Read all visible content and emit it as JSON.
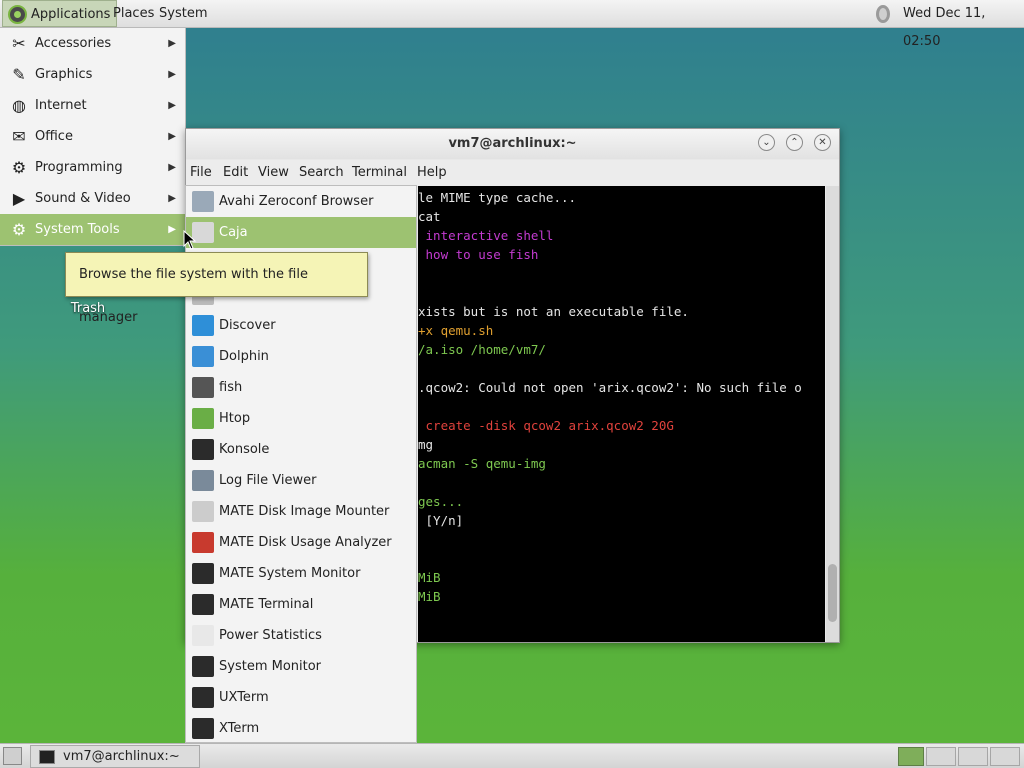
{
  "top_panel": {
    "applications": "Applications",
    "places": "Places",
    "system": "System",
    "clock": "Wed Dec 11, 02:50"
  },
  "desktop": {
    "trash": "Trash"
  },
  "main_menu": {
    "items": [
      {
        "label": "Accessories",
        "icon": "accessories-icon"
      },
      {
        "label": "Graphics",
        "icon": "graphics-icon"
      },
      {
        "label": "Internet",
        "icon": "internet-icon"
      },
      {
        "label": "Office",
        "icon": "office-icon"
      },
      {
        "label": "Programming",
        "icon": "programming-icon"
      },
      {
        "label": "Sound & Video",
        "icon": "sound-video-icon"
      },
      {
        "label": "System Tools",
        "icon": "system-tools-icon",
        "active": true
      }
    ]
  },
  "tooltip": "Browse the file system with the file manager",
  "terminal": {
    "title": "vm7@archlinux:~",
    "menu": [
      "File",
      "Edit",
      "View",
      "Search",
      "Terminal",
      "Help"
    ],
    "lines": [
      {
        "text": "le MIME type cache...",
        "color": "#e6e6e6"
      },
      {
        "text": "cat",
        "color": "#e6e6e6"
      },
      {
        "text": " interactive shell",
        "color": "#c43bd1"
      },
      {
        "text": " how to use fish",
        "color": "#c43bd1"
      },
      {
        "text": "",
        "color": "#e6e6e6"
      },
      {
        "text": "",
        "color": "#e6e6e6"
      },
      {
        "text": "xists but is not an executable file.",
        "color": "#e6e6e6"
      },
      {
        "text": "+x qemu.sh",
        "color": "#e0a030"
      },
      {
        "text": "/a.iso /home/vm7/",
        "color": "#7ec850"
      },
      {
        "text": "",
        "color": "#e6e6e6"
      },
      {
        "text": ".qcow2: Could not open 'arix.qcow2': No such file o",
        "color": "#e6e6e6"
      },
      {
        "text": "",
        "color": "#e6e6e6"
      },
      {
        "text": " create -disk qcow2 arix.qcow2 20G",
        "color": "#e0423c"
      },
      {
        "text": "mg",
        "color": "#e6e6e6"
      },
      {
        "text": "acman -S qemu-img",
        "color": "#7ec850"
      },
      {
        "text": "",
        "color": "#e6e6e6"
      },
      {
        "text": "ges...",
        "color": "#7ec850"
      },
      {
        "text": " [Y/n]",
        "color": "#e6e6e6"
      },
      {
        "text": "",
        "color": "#e6e6e6"
      },
      {
        "text": "",
        "color": "#e6e6e6"
      },
      {
        "text": "MiB",
        "color": "#7ec850"
      },
      {
        "text": "MiB",
        "color": "#7ec850"
      }
    ]
  },
  "sub_menu": {
    "items": [
      {
        "label": "Avahi Zeroconf Browser",
        "icon": "avahi-icon",
        "color": "#9aa9b8"
      },
      {
        "label": "Caja",
        "icon": "caja-icon",
        "color": "#d8d8d8",
        "active": true
      },
      {
        "label": "",
        "icon": "hidden-icon",
        "color": "#bbbbbb"
      },
      {
        "label": "",
        "icon": "hidden-icon",
        "color": "#bbbbbb"
      },
      {
        "label": "Discover",
        "icon": "discover-icon",
        "color": "#2e8fd8"
      },
      {
        "label": "Dolphin",
        "icon": "dolphin-icon",
        "color": "#3a8fd6"
      },
      {
        "label": "fish",
        "icon": "fish-icon",
        "color": "#555555"
      },
      {
        "label": "Htop",
        "icon": "htop-icon",
        "color": "#6aae46"
      },
      {
        "label": "Konsole",
        "icon": "konsole-icon",
        "color": "#2b2b2b"
      },
      {
        "label": "Log File Viewer",
        "icon": "log-viewer-icon",
        "color": "#7a8a9a"
      },
      {
        "label": "MATE Disk Image Mounter",
        "icon": "disk-mounter-icon",
        "color": "#cccccc"
      },
      {
        "label": "MATE Disk Usage Analyzer",
        "icon": "disk-analyzer-icon",
        "color": "#c83a2e"
      },
      {
        "label": "MATE System Monitor",
        "icon": "system-monitor-icon",
        "color": "#2b2b2b"
      },
      {
        "label": "MATE Terminal",
        "icon": "terminal-icon",
        "color": "#2b2b2b"
      },
      {
        "label": "Power Statistics",
        "icon": "power-stats-icon",
        "color": "#e8e8e8"
      },
      {
        "label": "System Monitor",
        "icon": "system-monitor-icon",
        "color": "#2b2b2b"
      },
      {
        "label": "UXTerm",
        "icon": "uxterm-icon",
        "color": "#2b2b2b"
      },
      {
        "label": "XTerm",
        "icon": "xterm-icon",
        "color": "#2b2b2b"
      }
    ]
  },
  "taskbar": {
    "terminal_task": "vm7@archlinux:~"
  }
}
